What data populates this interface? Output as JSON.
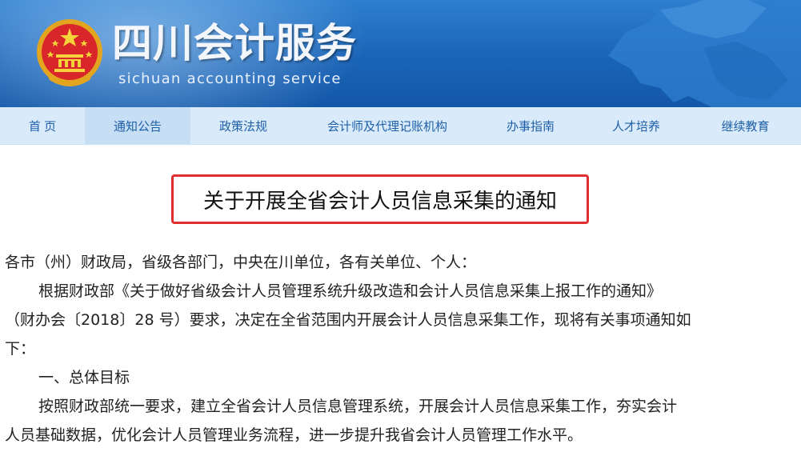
{
  "site": {
    "title": "四川会计服务",
    "subtitle": "sichuan accounting service"
  },
  "nav": {
    "items": [
      {
        "label": "首 页"
      },
      {
        "label": "通知公告"
      },
      {
        "label": "政策法规"
      },
      {
        "label": "会计师及代理记账机构"
      },
      {
        "label": "办事指南"
      },
      {
        "label": "人才培养"
      },
      {
        "label": "继续教育"
      }
    ],
    "active": "通知公告"
  },
  "article": {
    "title": "关于开展全省会计人员信息采集的通知",
    "lines": [
      "各市（州）财政局，省级各部门，中央在川单位，各有关单位、个人：",
      "根据财政部《关于做好省级会计人员管理系统升级改造和会计人员信息采集上报工作的通知》",
      "（财办会〔2018〕28 号）要求，决定在全省范围内开展会计人员信息采集工作，现将有关事项通知如",
      "下：",
      "一、总体目标",
      "按照财政部统一要求，建立全省会计人员信息管理系统，开展会计人员信息采集工作，夯实会计",
      "人员基础数据，优化会计人员管理业务流程，进一步提升我省会计人员管理工作水平。"
    ]
  },
  "colors": {
    "banner": "#1a63b6",
    "nav_bg": "#d9ebfb",
    "nav_active_bg": "#c6dff5",
    "nav_text": "#1f5fa7",
    "highlight_border": "#e22e2e"
  },
  "icons": {
    "emblem": "national-emblem-icon",
    "map": "sichuan-map-decoration"
  }
}
